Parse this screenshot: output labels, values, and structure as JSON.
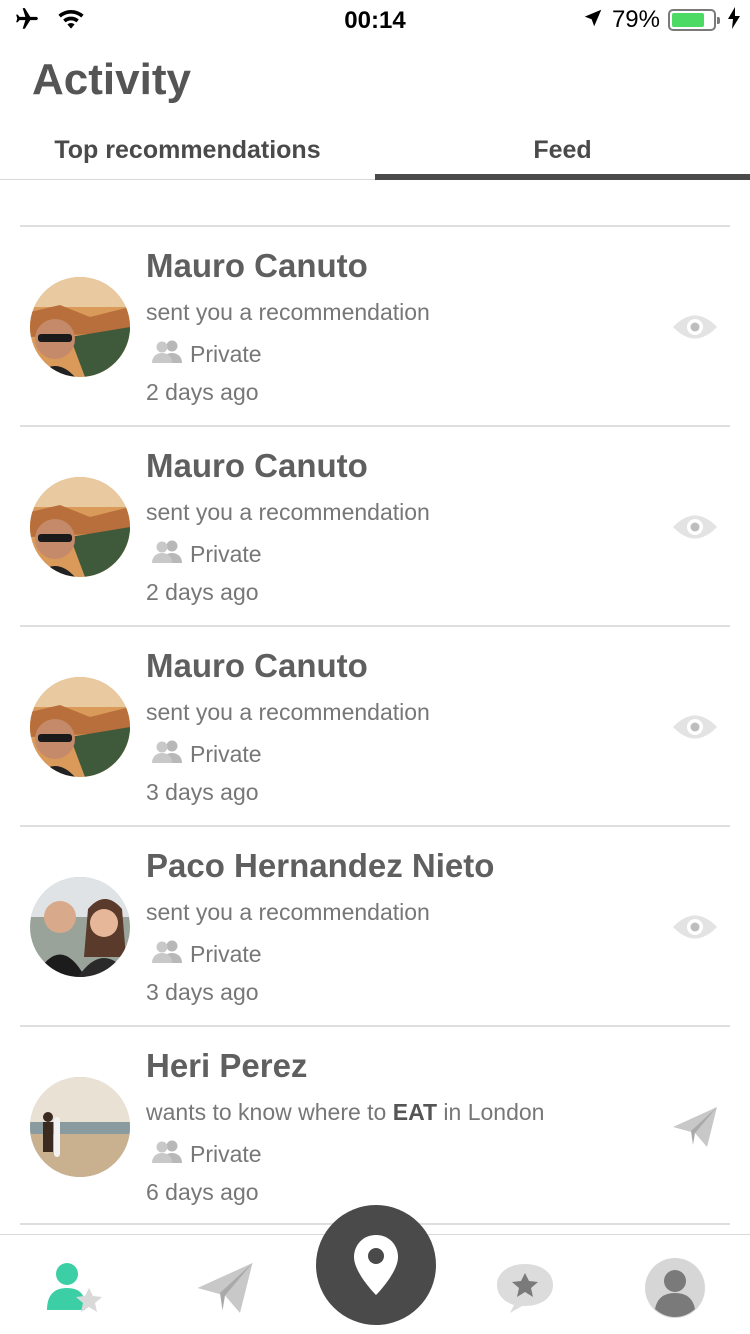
{
  "status_bar": {
    "time": "00:14",
    "battery_percent": "79%",
    "battery_level": 0.79,
    "icons": [
      "airplane-icon",
      "wifi-icon",
      "location-arrow-icon",
      "battery-icon",
      "charging-bolt-icon"
    ]
  },
  "page": {
    "title": "Activity"
  },
  "tabs": [
    {
      "label": "Top recommendations",
      "active": false
    },
    {
      "label": "Feed",
      "active": true
    }
  ],
  "feed": {
    "items": [
      {
        "name": "Mauro Canuto",
        "text": "sent you a recommendation",
        "privacy": "Private",
        "time": "2 days ago",
        "action_icon": "eye-icon"
      },
      {
        "name": "Mauro Canuto",
        "text": "sent you a recommendation",
        "privacy": "Private",
        "time": "2 days ago",
        "action_icon": "eye-icon"
      },
      {
        "name": "Mauro Canuto",
        "text": "sent you a recommendation",
        "privacy": "Private",
        "time": "3 days ago",
        "action_icon": "eye-icon"
      },
      {
        "name": "Paco Hernandez Nieto",
        "text": "sent you a recommendation",
        "privacy": "Private",
        "time": "3 days ago",
        "action_icon": "eye-icon"
      },
      {
        "name": "Heri Perez",
        "text_prefix": "wants to know where to ",
        "text_bold": "EAT",
        "text_suffix": " in London",
        "privacy": "Private",
        "time": "6 days ago",
        "action_icon": "paper-plane-icon"
      }
    ]
  },
  "bottom_nav": {
    "items": [
      "activity-icon",
      "send-icon",
      "map-pin-icon",
      "favorites-icon",
      "profile-icon"
    ],
    "active_color": "#3ccfa6"
  }
}
